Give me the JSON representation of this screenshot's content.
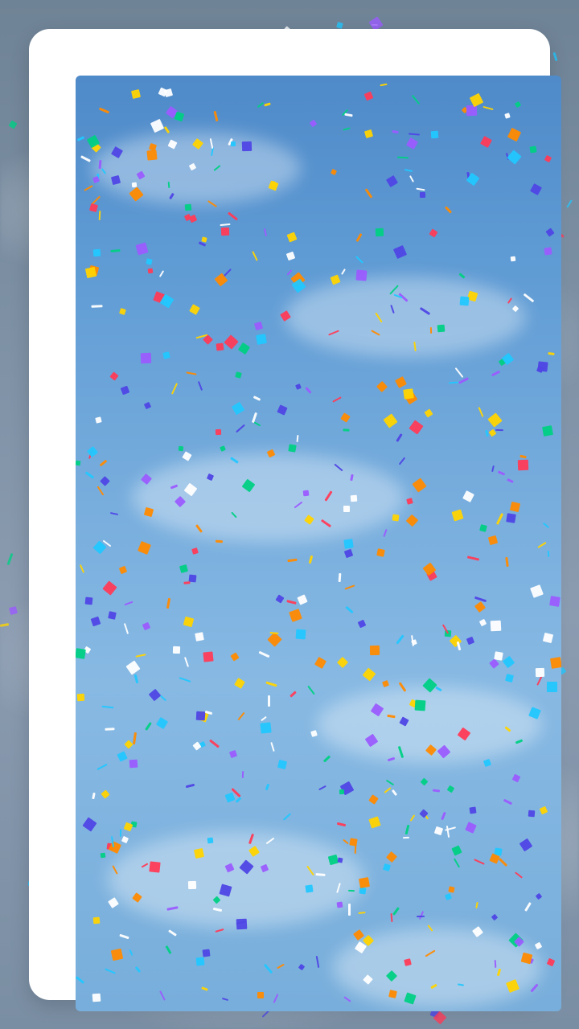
{
  "screen": {
    "title": "",
    "confetti_palette": [
      "#ff3b57",
      "#ff8a00",
      "#ffd400",
      "#00d084",
      "#22c7ff",
      "#4f46e5",
      "#9b5cff",
      "#ffffff"
    ],
    "background_theme": "blurred-sky",
    "preview_theme": "sky-confetti"
  }
}
